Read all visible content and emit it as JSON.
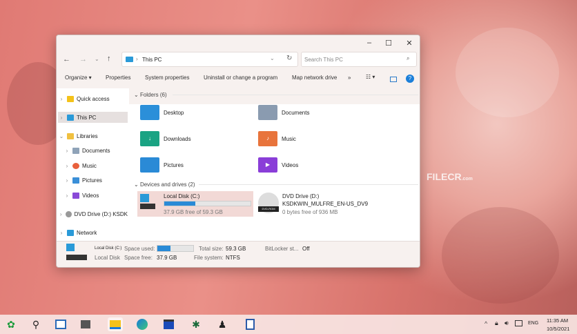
{
  "window": {
    "address": "This PC",
    "search_placeholder": "Search This PC"
  },
  "toolbar": {
    "organize": "Organize ▾",
    "properties": "Properties",
    "system_properties": "System properties",
    "uninstall": "Uninstall or change a program",
    "map_drive": "Map network drive",
    "more": "»"
  },
  "sidebar": {
    "items": [
      {
        "label": "Quick access"
      },
      {
        "label": "This PC"
      },
      {
        "label": "Libraries"
      },
      {
        "label": "Documents"
      },
      {
        "label": "Music"
      },
      {
        "label": "Pictures"
      },
      {
        "label": "Videos"
      },
      {
        "label": "DVD Drive (D:) KSDK"
      },
      {
        "label": "Network"
      }
    ]
  },
  "folders": {
    "header": "Folders (6)",
    "items": [
      {
        "label": "Desktop"
      },
      {
        "label": "Documents"
      },
      {
        "label": "Downloads"
      },
      {
        "label": "Music"
      },
      {
        "label": "Pictures"
      },
      {
        "label": "Videos"
      }
    ]
  },
  "drives": {
    "header": "Devices and drives (2)",
    "local": {
      "name": "Local Disk (C:)",
      "free": "37.9 GB free of 59.3 GB",
      "used_fraction": 0.36
    },
    "dvd": {
      "name": "DVD Drive (D:)",
      "label": "KSDKWIN_MULFRE_EN-US_DV9",
      "free": "0 bytes free of 936 MB",
      "badge": "DVD-ROM"
    }
  },
  "details": {
    "name": "Local Disk (C:)",
    "type": "Local Disk",
    "space_used_label": "Space used:",
    "space_free_label": "Space free:",
    "space_free": "37.9 GB",
    "total_label": "Total size:",
    "total": "59.3 GB",
    "fs_label": "File system:",
    "fs": "NTFS",
    "bitlocker_label": "BitLocker st...",
    "bitlocker": "Off",
    "used_fraction": 0.36
  },
  "watermark": "FILECR",
  "watermark_sub": ".com",
  "tray": {
    "lang": "ENG",
    "time": "11:35 AM",
    "date": "10/5/2021"
  }
}
